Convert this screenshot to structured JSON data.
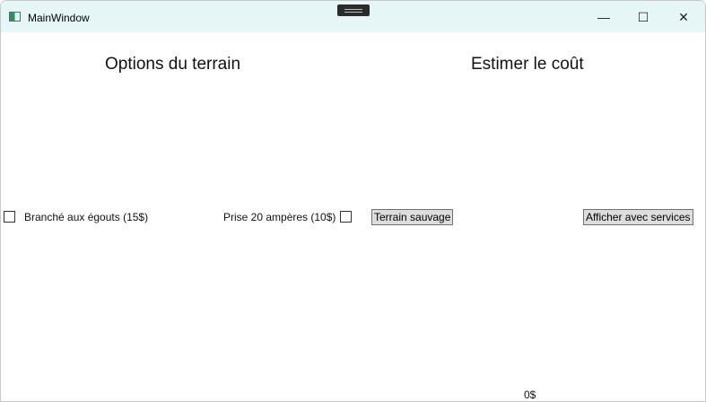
{
  "window": {
    "title": "MainWindow"
  },
  "left": {
    "heading": "Options du terrain",
    "sewer_label": "Branché aux égouts (15$)",
    "outlet_label": "Prise 20 ampères (10$)",
    "wild_button": "Terrain sauvage"
  },
  "right": {
    "heading": "Estimer le coût",
    "services_button": "Afficher avec services",
    "total": "0$"
  },
  "controls": {
    "minimize": "—",
    "maximize": "☐",
    "close": "✕"
  }
}
